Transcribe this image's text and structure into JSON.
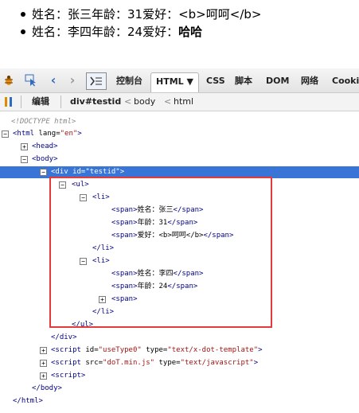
{
  "rendered_list": [
    {
      "prefix": "姓名：张三年龄：31爱好：",
      "bold": "",
      "suffix": "<b>呵呵</b>"
    },
    {
      "prefix": "姓名：李四年龄：24爱好：",
      "bold": "哈哈",
      "suffix": ""
    }
  ],
  "toolbar": {
    "tabs": [
      "控制台",
      "HTML ▼",
      "CSS",
      "脚本",
      "DOM",
      "网络",
      "Cooki"
    ],
    "icons": [
      "firebug-bug-icon",
      "inspect-pointer-icon",
      "back-arrow-icon",
      "forward-arrow-icon",
      "console-toggle-icon"
    ]
  },
  "subbar": {
    "edit": "编辑",
    "crumbs": [
      "div#testid",
      "body",
      "html"
    ],
    "crumb_sep": "<"
  },
  "tree": [
    {
      "doctype": "<!DOCTYPE html>"
    },
    {
      "t1": "<html ",
      "a1": "lang=",
      "v1": "\"en\"",
      "t2": ">"
    },
    {
      "tw": "+",
      "t1": "<head>"
    },
    {
      "tw": "−",
      "t1": "<body>"
    },
    {
      "tw": "−",
      "t1": "<div ",
      "a1": "id=",
      "v1": "\"testid\"",
      "t2": ">"
    },
    {
      "tw": "−",
      "t1": "<ul>"
    },
    {
      "tw": "−",
      "t1": "<li>"
    },
    {
      "t1": "<span>",
      "x": "姓名：张三",
      "t2": "</span>"
    },
    {
      "t1": "<span>",
      "x": "年龄：31",
      "t2": "</span>"
    },
    {
      "t1": "<span>",
      "x": "爱好：<b>呵呵</b>",
      "t2": "</span>"
    },
    {
      "t1": "</li>"
    },
    {
      "tw": "−",
      "t1": "<li>"
    },
    {
      "t1": "<span>",
      "x": "姓名：李四",
      "t2": "</span>"
    },
    {
      "t1": "<span>",
      "x": "年龄：24",
      "t2": "</span>"
    },
    {
      "tw": "+",
      "t1": "<span>"
    },
    {
      "t1": "</li>"
    },
    {
      "t1": "</ul>"
    },
    {
      "t1": "</div>"
    },
    {
      "tw": "+",
      "t1": "<script ",
      "a1": "id=",
      "v1": "\"useType0\"",
      "a2": " type=",
      "v2": "\"text/x-dot-template\"",
      "t2": ">"
    },
    {
      "tw": "+",
      "t1": "<script ",
      "a1": "src=",
      "v1": "\"doT.min.js\"",
      "a2": " type=",
      "v2": "\"text/javascript\"",
      "t2": ">"
    },
    {
      "tw": "+",
      "t1": "<script>"
    },
    {
      "t1": "</body>"
    },
    {
      "t1": "</html>"
    }
  ],
  "colors": {
    "selection": "#3875d7",
    "highlight_box": "#e53a3a",
    "tag": "#000088",
    "value": "#a31515"
  }
}
